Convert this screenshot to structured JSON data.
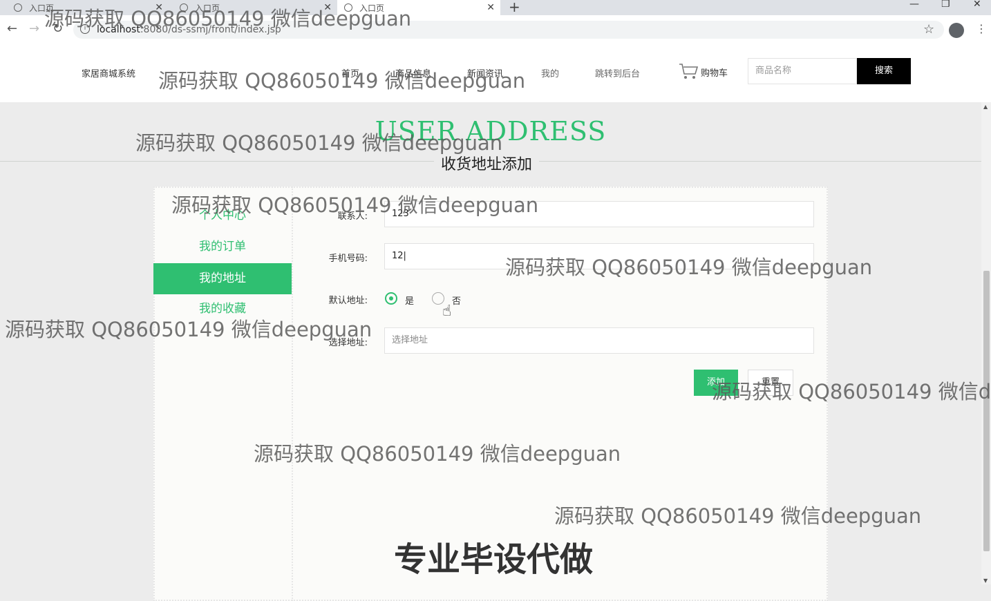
{
  "browser": {
    "tabs": [
      {
        "title": "入口页",
        "close": "✕"
      },
      {
        "title": "入口页",
        "close": "✕"
      },
      {
        "title": "入口页",
        "close": "✕"
      }
    ],
    "new_tab": "+",
    "url_host": "localhost",
    "url_rest": ":8080/ds-ssmj/front/index.jsp",
    "window_controls": {
      "minimize": "—",
      "restore": "❐",
      "close": "✕"
    }
  },
  "header": {
    "brand": "家居商城系统",
    "menu": [
      "首页",
      "商品信息",
      "新闻资讯",
      "我的",
      "跳转到后台"
    ],
    "cart_label": "购物车",
    "search_placeholder": "商品名称",
    "search_button": "搜索"
  },
  "page_title": {
    "en": "USER ADDRESS",
    "cn": "收货地址添加"
  },
  "sidebar": {
    "items": [
      {
        "label": "个人中心",
        "active": false
      },
      {
        "label": "我的订单",
        "active": false
      },
      {
        "label": "我的地址",
        "active": true
      },
      {
        "label": "我的收藏",
        "active": false
      }
    ]
  },
  "form": {
    "contact_label": "联系人:",
    "contact_value": "123",
    "phone_label": "手机号码:",
    "phone_value": "12|",
    "default_label": "默认地址:",
    "default_yes": "是",
    "default_no": "否",
    "default_selected": "是",
    "address_label": "选择地址:",
    "address_placeholder": "选择地址",
    "add_button": "添加",
    "reset_button": "重置"
  },
  "watermarks": {
    "text": "源码获取 QQ86050149 微信deepguan",
    "clipped": "源码获取 QQ86050149 微信d",
    "big": "专业毕设代做"
  },
  "colors": {
    "accent": "#2fbf71",
    "page_bg": "#ececec",
    "search_button_bg": "#000000"
  }
}
